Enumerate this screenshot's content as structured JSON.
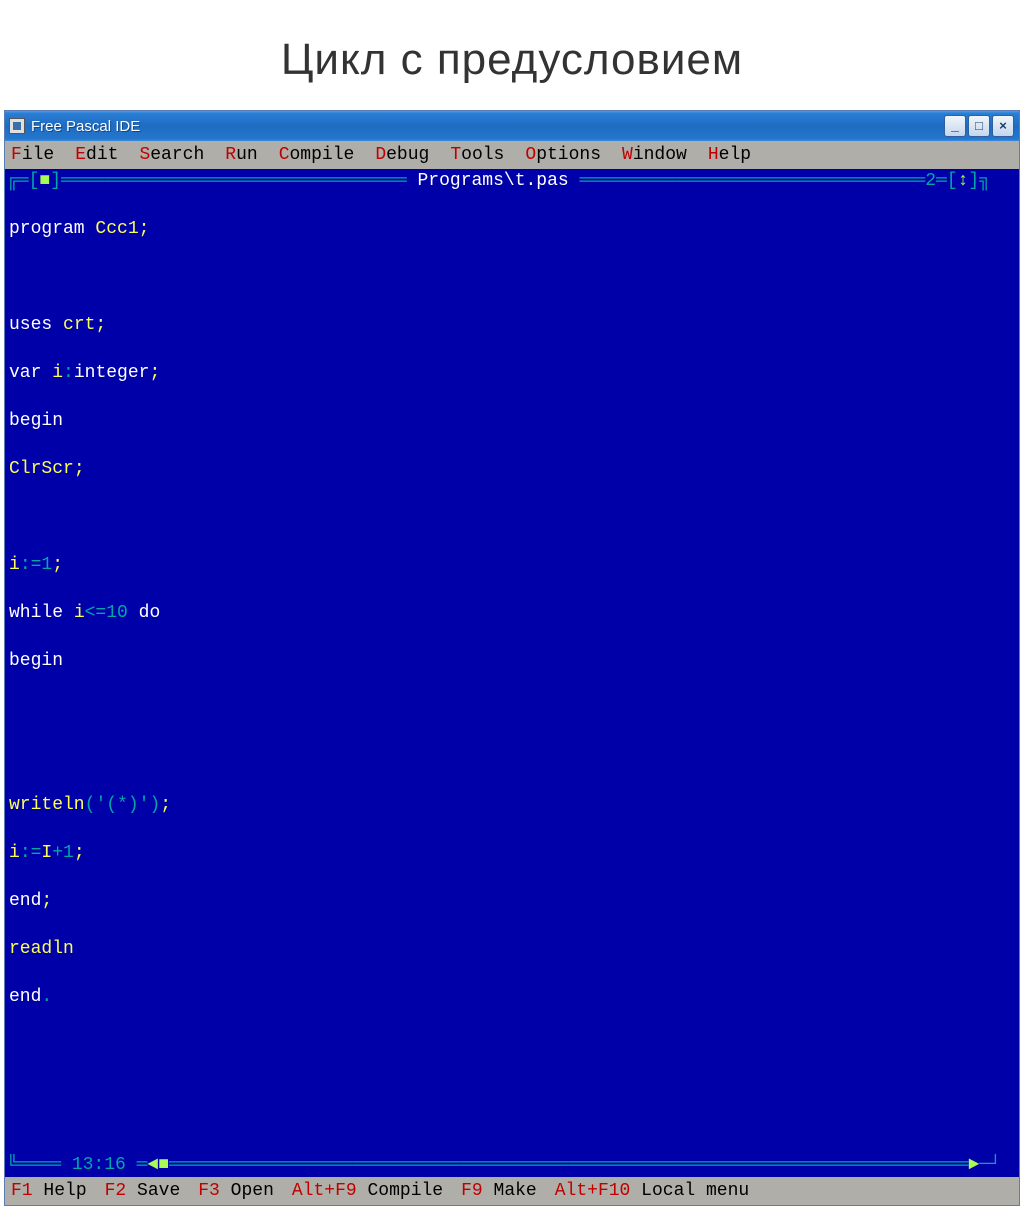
{
  "slide_title": "Цикл с предусловием",
  "window": {
    "title": "Free Pascal IDE",
    "btn_min": "_",
    "btn_max": "□",
    "btn_close": "×"
  },
  "menus": [
    {
      "hot": "F",
      "rest": "ile"
    },
    {
      "hot": "E",
      "rest": "dit"
    },
    {
      "hot": "S",
      "rest": "earch"
    },
    {
      "hot": "R",
      "rest": "un"
    },
    {
      "hot": "C",
      "rest": "ompile"
    },
    {
      "hot": "D",
      "rest": "ebug"
    },
    {
      "hot": "T",
      "rest": "ools"
    },
    {
      "hot": "O",
      "rest": "ptions"
    },
    {
      "hot": "W",
      "rest": "indow"
    },
    {
      "hot": "H",
      "rest": "elp"
    }
  ],
  "editor": {
    "filename": "Programs\\t.pas",
    "window_number": "2",
    "cursor_pos": "13:16",
    "close_glyph": "■",
    "maximize_glyph": "↕",
    "scroll_left": "◄",
    "scroll_right": "►",
    "scroll_thumb": "■"
  },
  "code": {
    "l1_kw": "program ",
    "l1_id": "Ccc1",
    "l1_t": ";",
    "l3_kw": "uses ",
    "l3_id": "crt",
    "l3_t": ";",
    "l4_kw": "var ",
    "l4_id": "i",
    "l4_c": ":",
    "l4_ty": "integer",
    "l4_t": ";",
    "l5": "begin",
    "l6_id": "ClrScr",
    "l6_t": ";",
    "l8_id": "i",
    "l8_op": ":=",
    "l8_n": "1",
    "l8_t": ";",
    "l9_kw1": "while ",
    "l9_id": "i",
    "l9_op": "<=",
    "l9_n": "10",
    "l9_kw2": " do",
    "l10": "begin",
    "l13_id": "writeln",
    "l13_p1": "(",
    "l13_s": "'(*)'",
    "l13_p2": ")",
    "l13_t": ";",
    "l14_id": "i",
    "l14_op": ":=",
    "l14_id2": "I",
    "l14_pl": "+",
    "l14_n": "1",
    "l14_t": ";",
    "l15_kw": "end",
    "l15_t": ";",
    "l16": "readln",
    "l17_kw": "end",
    "l17_t": "."
  },
  "status": [
    {
      "key": "F1",
      "label": " Help"
    },
    {
      "key": "F2",
      "label": " Save"
    },
    {
      "key": "F3",
      "label": " Open"
    },
    {
      "key": "Alt+F9",
      "label": " Compile"
    },
    {
      "key": "F9",
      "label": " Make"
    },
    {
      "key": "Alt+F10",
      "label": " Local menu"
    }
  ]
}
